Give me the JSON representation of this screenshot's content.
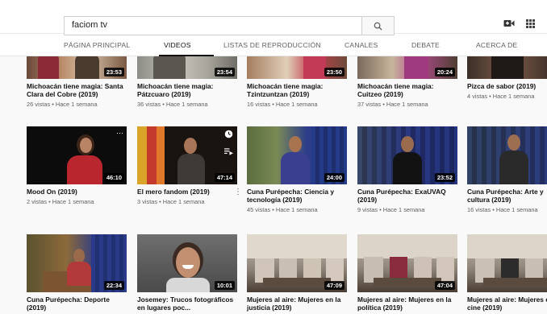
{
  "search": {
    "query": "faciom tv"
  },
  "header": {
    "camera_icon": "video-camera-icon",
    "apps_icon": "apps-grid-icon"
  },
  "tabs": [
    {
      "label": "PÁGINA PRINCIPAL"
    },
    {
      "label": "VIDEOS"
    },
    {
      "label": "LISTAS DE REPRODUCCIÓN"
    },
    {
      "label": "CANALES"
    },
    {
      "label": "DEBATE"
    },
    {
      "label": "ACERCA DE"
    }
  ],
  "colors": {
    "accent_tab_underline": "#111111",
    "duration_badge": "#000000"
  },
  "rows": [
    [
      {
        "title": "Michoacán tiene magia: Santa Clara del Cobre (2019)",
        "meta": "26 vistas • Hace 1 semana",
        "duration": "23:53"
      },
      {
        "title": "Michoacán tiene magia: Pátzcuaro (2019)",
        "meta": "36 vistas • Hace 1 semana",
        "duration": "23:54"
      },
      {
        "title": "Michoacán tiene magia: Tzintzuntzan (2019)",
        "meta": "16 vistas • Hace 1 semana",
        "duration": "23:50"
      },
      {
        "title": "Michoacán tiene magia: Cuitzeo (2019)",
        "meta": "37 vistas • Hace 1 semana",
        "duration": "20:24"
      },
      {
        "title": "Pizca de sabor (2019)",
        "meta": "4 vistas • Hace 1 semana",
        "duration": ""
      }
    ],
    [
      {
        "title": "Mood On (2019)",
        "meta": "2 vistas • Hace 1 semana",
        "duration": "46:10"
      },
      {
        "title": "El mero fandom (2019)",
        "meta": "3 vistas • Hace 1 semana",
        "duration": "47:14"
      },
      {
        "title": "Cuna Purépecha: Ciencia y tecnología (2019)",
        "meta": "45 vistas • Hace 1 semana",
        "duration": "24:00"
      },
      {
        "title": "Cuna Purépecha: ExaUVAQ (2019)",
        "meta": "9 vistas • Hace 1 semana",
        "duration": "23:52"
      },
      {
        "title": "Cuna Purépecha: Arte y cultura (2019)",
        "meta": "16 vistas • Hace 1 semana",
        "duration": ""
      }
    ],
    [
      {
        "title": "Cuna Purépecha: Deporte (2019)",
        "meta": "",
        "duration": "22:34"
      },
      {
        "title": "Josemey: Trucos fotográficos en lugares poc...",
        "meta": "",
        "duration": "10:01"
      },
      {
        "title": "Mujeres al aire: Mujeres en la justicia (2019)",
        "meta": "",
        "duration": "47:09"
      },
      {
        "title": "Mujeres al aire: Mujeres en la política (2019)",
        "meta": "",
        "duration": "47:04"
      },
      {
        "title": "Mujeres al aire: Mujeres en el cine (2019)",
        "meta": "",
        "duration": ""
      }
    ]
  ]
}
